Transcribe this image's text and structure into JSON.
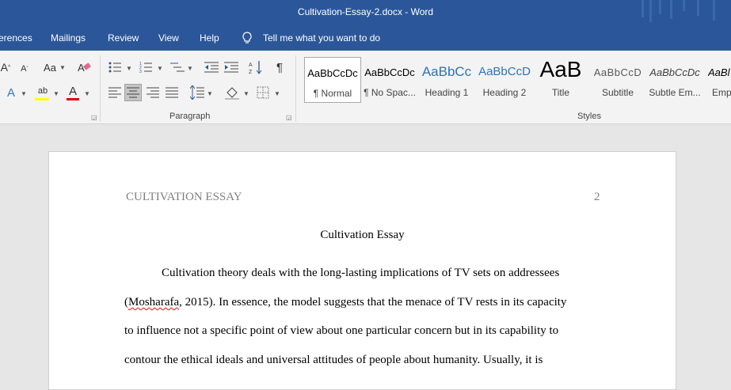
{
  "window": {
    "title": "Cultivation-Essay-2.docx  -  Word"
  },
  "tabs": [
    "erences",
    "Mailings",
    "Review",
    "View",
    "Help"
  ],
  "tell_me": {
    "label": "Tell me what you want to do"
  },
  "groups": {
    "paragraph": "Paragraph",
    "styles": "Styles"
  },
  "styles": [
    {
      "sample": "AaBbCcDc",
      "name": "¶ Normal"
    },
    {
      "sample": "AaBbCcDc",
      "name": "¶ No Spac..."
    },
    {
      "sample": "AaBbCc",
      "name": "Heading 1"
    },
    {
      "sample": "AaBbCcD",
      "name": "Heading 2"
    },
    {
      "sample": "AaB",
      "name": "Title"
    },
    {
      "sample": "AaBbCcD",
      "name": "Subtitle"
    },
    {
      "sample": "AaBbCcDc",
      "name": "Subtle Em..."
    },
    {
      "sample": "AaBl",
      "name": "Emp"
    }
  ],
  "document": {
    "running_head": "CULTIVATION ESSAY",
    "page_number": "2",
    "title": "Cultivation Essay",
    "lines": [
      "Cultivation theory deals with the long-lasting implications of TV sets on addressees",
      "Mosharafa",
      ", 2015). In essence, the model suggests that the menace of TV rests in its capacity",
      "to influence not a specific point of view about one particular concern but in its capability to",
      "contour the ethical ideals and universal attitudes of people about humanity. Usually, it is"
    ],
    "paren_open": "("
  },
  "colors": {
    "ribbon_blue": "#2b579a",
    "heading_blue": "#2e74b5"
  }
}
